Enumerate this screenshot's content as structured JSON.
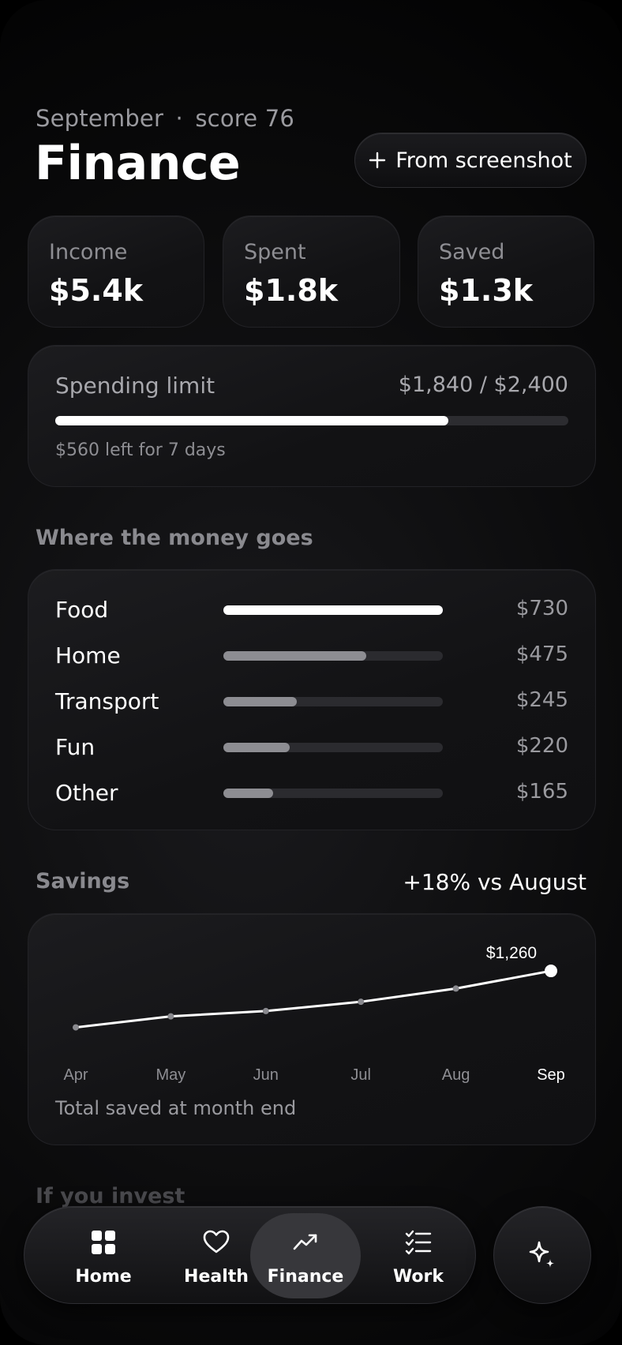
{
  "header": {
    "month": "September",
    "separator": "·",
    "score": "score 76",
    "title": "Finance",
    "screenshot_button": "From screenshot"
  },
  "stats": [
    {
      "label": "Income",
      "value": "$5.4k"
    },
    {
      "label": "Spent",
      "value": "$1.8k"
    },
    {
      "label": "Saved",
      "value": "$1.3k"
    }
  ],
  "limit": {
    "label": "Spending limit",
    "value": "$1,840 / $2,400",
    "progress": 0.7667,
    "note": "$560 left for 7 days"
  },
  "categories": {
    "title": "Where the money goes",
    "items": [
      {
        "name": "Food",
        "amount": "$730",
        "value": 730
      },
      {
        "name": "Home",
        "amount": "$475",
        "value": 475
      },
      {
        "name": "Transport",
        "amount": "$245",
        "value": 245
      },
      {
        "name": "Fun",
        "amount": "$220",
        "value": 220
      },
      {
        "name": "Other",
        "amount": "$165",
        "value": 165
      }
    ]
  },
  "savings": {
    "title": "Savings",
    "delta": "+18% vs August",
    "note": "Total saved at month end"
  },
  "chart_data": {
    "type": "line",
    "categories": [
      "Apr",
      "May",
      "Jun",
      "Jul",
      "Aug",
      "Sep"
    ],
    "values": [
      620,
      745,
      805,
      910,
      1060,
      1260
    ],
    "highlight_label": "$1,260",
    "ylim": [
      500,
      1350
    ]
  },
  "next_section": {
    "title": "If you invest"
  },
  "nav": {
    "items": [
      {
        "label": "Home",
        "icon": "grid-icon"
      },
      {
        "label": "Health",
        "icon": "heart-icon"
      },
      {
        "label": "Finance",
        "icon": "trend-up-icon",
        "active": true
      },
      {
        "label": "Work",
        "icon": "checklist-icon"
      }
    ],
    "ai_icon": "sparkle-icon"
  },
  "colors": {
    "background": "#000000",
    "card": "#151517",
    "accent": "#ffffff",
    "muted": "#8e8e93"
  }
}
